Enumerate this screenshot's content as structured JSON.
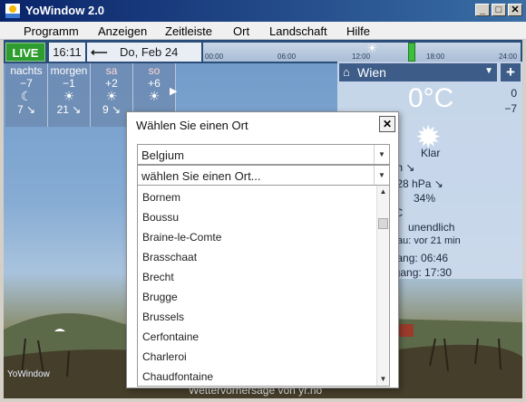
{
  "window": {
    "title": "YoWindow 2.0",
    "controls": [
      "_",
      "□",
      "✕"
    ]
  },
  "menu": [
    "Programm",
    "Anzeigen",
    "Zeitleiste",
    "Ort",
    "Landschaft",
    "Hilfe"
  ],
  "topbar": {
    "live_label": "LIVE",
    "time": "16:11",
    "date": "Do, Feb 24",
    "timeline_ticks": [
      "00:00",
      "06:00",
      "12:00",
      "18:00",
      "24:00"
    ]
  },
  "forecast": [
    {
      "name": "nachts",
      "temp": "−7",
      "icon": "☾",
      "small": "7 ↘"
    },
    {
      "name": "morgen",
      "temp": "−1",
      "icon": "☀",
      "small": "21 ↘"
    },
    {
      "name": "sa",
      "temp": "+2",
      "icon": "☀",
      "small": "9 ↘"
    },
    {
      "name": "so",
      "temp": "+6",
      "icon": "☀",
      "small": ""
    }
  ],
  "panel": {
    "location": "Wien",
    "temperature": "0°C",
    "side_temps": [
      "0",
      "−7"
    ],
    "condition": "Klar",
    "wind": "m/h ↘",
    "pressure": "1028 hPa ↘",
    "humidity": "34%",
    "dew": "5°C",
    "visibility": "unendlich",
    "updated_label": "au:",
    "updated": "vor 21 min",
    "sunrise": "ngang: 06:46",
    "sunset": "ergang: 17:30"
  },
  "footer": {
    "credit": "Wettervorhersage von yr.no",
    "logo": "YoWindow"
  },
  "dialog": {
    "title": "Wählen Sie einen Ort",
    "country": "Belgium",
    "place_placeholder": "wählen Sie einen Ort...",
    "places": [
      "Bornem",
      "Boussu",
      "Braine-le-Comte",
      "Brasschaat",
      "Brecht",
      "Brugge",
      "Brussels",
      "Cerfontaine",
      "Charleroi",
      "Chaudfontaine"
    ]
  }
}
